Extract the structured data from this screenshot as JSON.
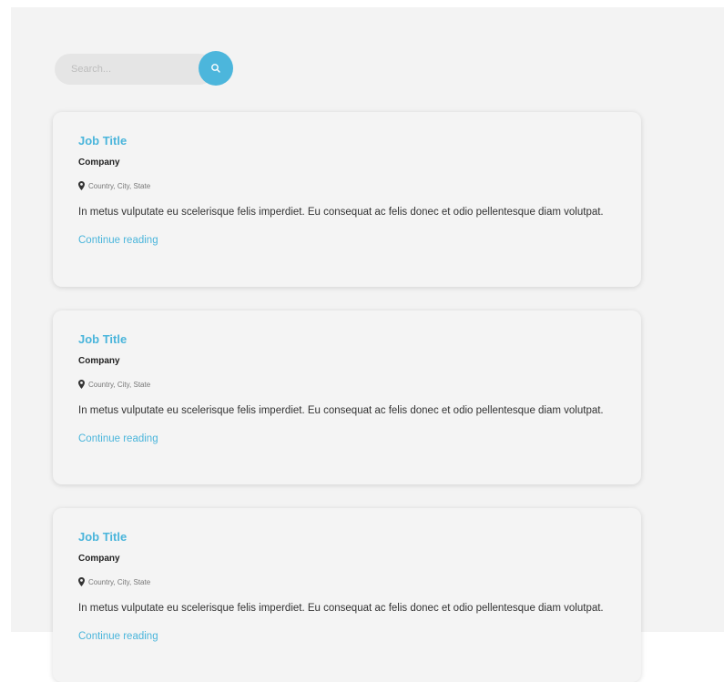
{
  "search": {
    "placeholder": "Search...",
    "icon": "search-icon",
    "accent_color": "#4cb6dc"
  },
  "jobs": [
    {
      "title": "Job Title",
      "company": "Company",
      "location": "Country, City, State",
      "location_icon": "map-pin-icon",
      "description": "In metus vulputate eu scelerisque felis imperdiet. Eu consequat ac felis donec et odio pellentesque diam volutpat.",
      "link_label": "Continue reading"
    },
    {
      "title": "Job Title",
      "company": "Company",
      "location": "Country, City, State",
      "location_icon": "map-pin-icon",
      "description": "In metus vulputate eu scelerisque felis imperdiet. Eu consequat ac felis donec et odio pellentesque diam volutpat.",
      "link_label": "Continue reading"
    },
    {
      "title": "Job Title",
      "company": "Company",
      "location": "Country, City, State",
      "location_icon": "map-pin-icon",
      "description": "In metus vulputate eu scelerisque felis imperdiet. Eu consequat ac felis donec et odio pellentesque diam volutpat.",
      "link_label": "Continue reading"
    }
  ],
  "colors": {
    "accent": "#4ab5db",
    "background": "#f3f3f3",
    "text": "#333333"
  }
}
